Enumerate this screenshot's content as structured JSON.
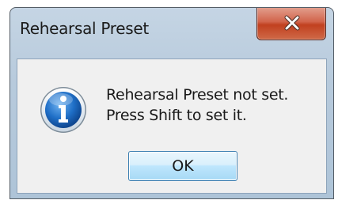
{
  "dialog": {
    "title": "Rehearsal Preset",
    "icon": "information-icon",
    "message_line1": "Rehearsal Preset not set.",
    "message_line2": "Press Shift to set it.",
    "ok_label": "OK",
    "close_icon": "close-icon"
  }
}
